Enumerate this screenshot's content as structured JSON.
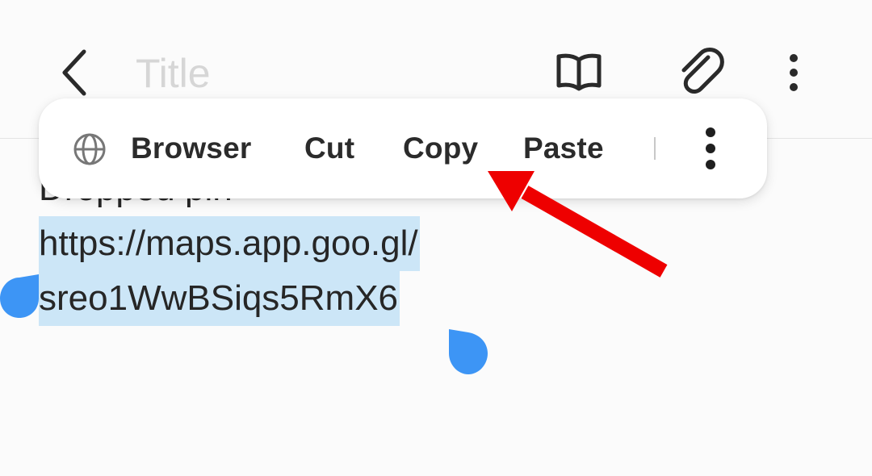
{
  "header": {
    "title_placeholder": "Title",
    "back_icon": "chevron-left-icon",
    "reader_icon": "book-open-icon",
    "attach_icon": "paperclip-icon",
    "more_icon": "more-vertical-icon"
  },
  "note": {
    "line1": "Dropped pin",
    "line2": "https://maps.app.goo.gl/",
    "line3": "sreo1WwBSiqs5RmX6"
  },
  "context_menu": {
    "items": [
      {
        "label": "Browser",
        "icon": "globe-icon"
      },
      {
        "label": "Cut"
      },
      {
        "label": "Copy"
      },
      {
        "label": "Paste"
      }
    ],
    "more_icon": "more-vertical-icon"
  },
  "colors": {
    "selection": "#cce6f7",
    "handle": "#3d95f5",
    "annotation_arrow": "#ee0000",
    "background": "#fbfbfb"
  }
}
